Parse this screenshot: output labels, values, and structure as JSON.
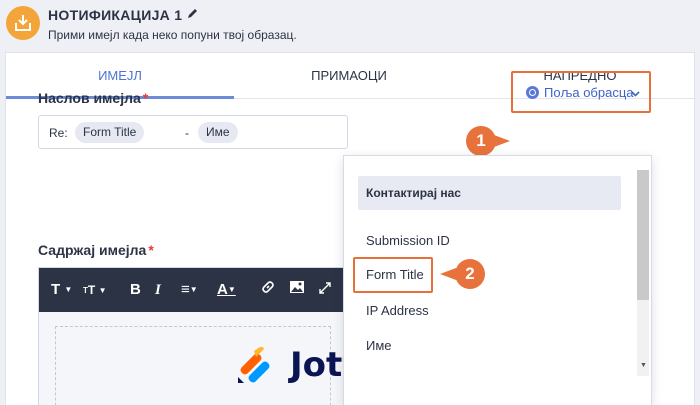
{
  "header": {
    "title": "НОТИФИКАЦИЈА 1",
    "subtitle": "Прими имејл када неко попуни твој образац.",
    "icon": "inbox-download-icon"
  },
  "tabs": [
    {
      "label": "ИМЕЈЛ",
      "active": true
    },
    {
      "label": "ПРИМАОЦИ",
      "active": false
    },
    {
      "label": "НАПРЕДНО",
      "active": false
    }
  ],
  "subject": {
    "label": "Наслов имејла",
    "required_mark": "*",
    "prefix": "Re:",
    "chips": [
      "Form Title",
      "Име"
    ],
    "separator": "-"
  },
  "form_fields_button": {
    "label": "Поља обрасца",
    "icon": "link-icon"
  },
  "content": {
    "label": "Садржај имејла",
    "required_mark": "*"
  },
  "toolbar": {
    "items": [
      "T",
      "T",
      "B",
      "I",
      "≡",
      "A"
    ]
  },
  "dropdown": {
    "group": "Контактирај нас",
    "items": [
      "Submission ID",
      "Form Title",
      "IP Address",
      "Име"
    ]
  },
  "badges": [
    "1",
    "2"
  ],
  "logo": {
    "text": "Jotform"
  },
  "colors": {
    "accent": "#4b74d6",
    "highlight": "#e5703a",
    "toolbar": "#2c3345"
  }
}
